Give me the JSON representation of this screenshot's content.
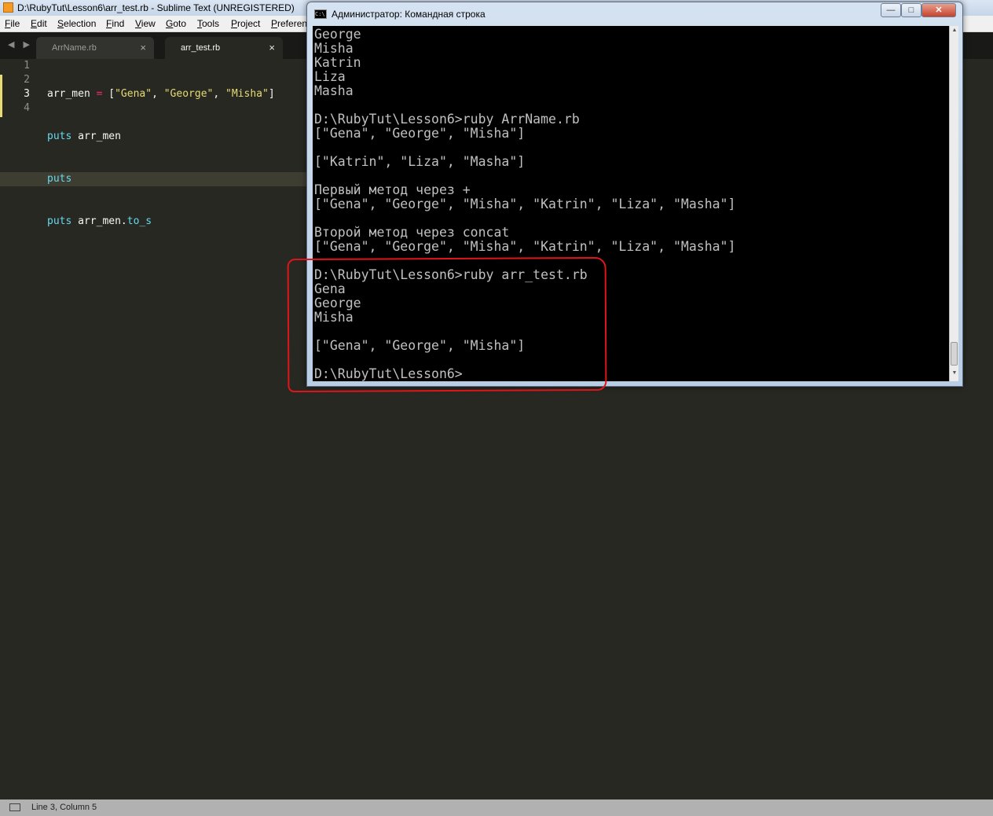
{
  "sublime": {
    "title": "D:\\RubyTut\\Lesson6\\arr_test.rb - Sublime Text (UNREGISTERED)",
    "menu": [
      "File",
      "Edit",
      "Selection",
      "Find",
      "View",
      "Goto",
      "Tools",
      "Project",
      "Preferen"
    ],
    "tabs": [
      {
        "label": "ArrName.rb",
        "close": "×"
      },
      {
        "label": "arr_test.rb",
        "close": "×"
      }
    ],
    "nav_arrows": "◀ ▶",
    "line_numbers": [
      "1",
      "2",
      "3",
      "4"
    ],
    "code": {
      "l1_var": "arr_men ",
      "l1_op": "=",
      "l1_open": " [",
      "l1_s1": "\"Gena\"",
      "l1_c1": ", ",
      "l1_s2": "\"George\"",
      "l1_c2": ", ",
      "l1_s3": "\"Misha\"",
      "l1_close": "]",
      "l2_kw": "puts",
      "l2_rest": " arr_men",
      "l3_kw": "puts",
      "l4_kw": "puts",
      "l4_var": " arr_men.",
      "l4_method": "to_s"
    },
    "status": "Line 3, Column 5"
  },
  "cmd": {
    "icon_text": "C:\\",
    "title": "Администратор: Командная строка",
    "buttons": {
      "minimize": "—",
      "maximize": "□",
      "close": "✕"
    },
    "output": "George\nMisha\nKatrin\nLiza\nMasha\n\nD:\\RubyTut\\Lesson6>ruby ArrName.rb\n[\"Gena\", \"George\", \"Misha\"]\n\n[\"Katrin\", \"Liza\", \"Masha\"]\n\nПервый метод через +\n[\"Gena\", \"George\", \"Misha\", \"Katrin\", \"Liza\", \"Masha\"]\n\nВторой метод через concat\n[\"Gena\", \"George\", \"Misha\", \"Katrin\", \"Liza\", \"Masha\"]\n\nD:\\RubyTut\\Lesson6>ruby arr_test.rb\nGena\nGeorge\nMisha\n\n[\"Gena\", \"George\", \"Misha\"]\n\nD:\\RubyTut\\Lesson6>",
    "scroll_up": "▲",
    "scroll_down": "▼"
  },
  "colors": {
    "editor_bg": "#272822",
    "highlight": "#e0141b"
  }
}
